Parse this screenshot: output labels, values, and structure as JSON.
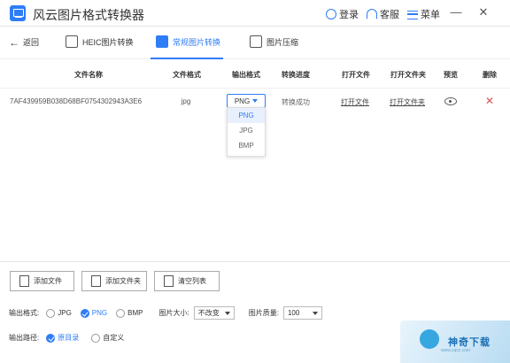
{
  "app": {
    "title": "风云图片格式转换器"
  },
  "titlebar": {
    "login": "登录",
    "service": "客服",
    "menu": "菜单",
    "minimize": "—",
    "close": "✕"
  },
  "nav": {
    "back": "返回",
    "tabs": [
      {
        "label": "HEIC图片转换",
        "active": false,
        "icon": "heic-icon"
      },
      {
        "label": "常规图片转换",
        "active": true,
        "icon": "convert-icon"
      },
      {
        "label": "图片压缩",
        "active": false,
        "icon": "compress-icon"
      }
    ]
  },
  "table": {
    "headers": [
      "文件名称",
      "文件格式",
      "输出格式",
      "转换进度",
      "打开文件",
      "打开文件夹",
      "预览",
      "删除"
    ],
    "rows": [
      {
        "file_name": "7AF439959B038D68BF0754302943A3E6",
        "file_format": "jpg",
        "output_format": "PNG",
        "progress": "转换成功",
        "open_file": "打开文件",
        "open_folder": "打开文件夹"
      }
    ]
  },
  "dropdown": {
    "options": [
      "PNG",
      "JPG",
      "BMP"
    ],
    "selected": "PNG"
  },
  "buttons": {
    "add_file": "添加文件",
    "add_folder": "添加文件夹",
    "clear_list": "清空列表"
  },
  "output_format": {
    "label": "输出格式:",
    "options": [
      "JPG",
      "PNG",
      "BMP"
    ],
    "selected": "PNG"
  },
  "image_size": {
    "label": "图片大小:",
    "value": "不改变"
  },
  "image_quality": {
    "label": "图片质量:",
    "value": "100"
  },
  "output_path": {
    "label": "输出路径:",
    "options": [
      "原目录",
      "自定义"
    ],
    "selected": "原目录"
  },
  "watermark": {
    "text": "神奇下载",
    "sub": "www.cqxz.com"
  },
  "colors": {
    "accent": "#2f7df6",
    "delete": "#e05050"
  }
}
